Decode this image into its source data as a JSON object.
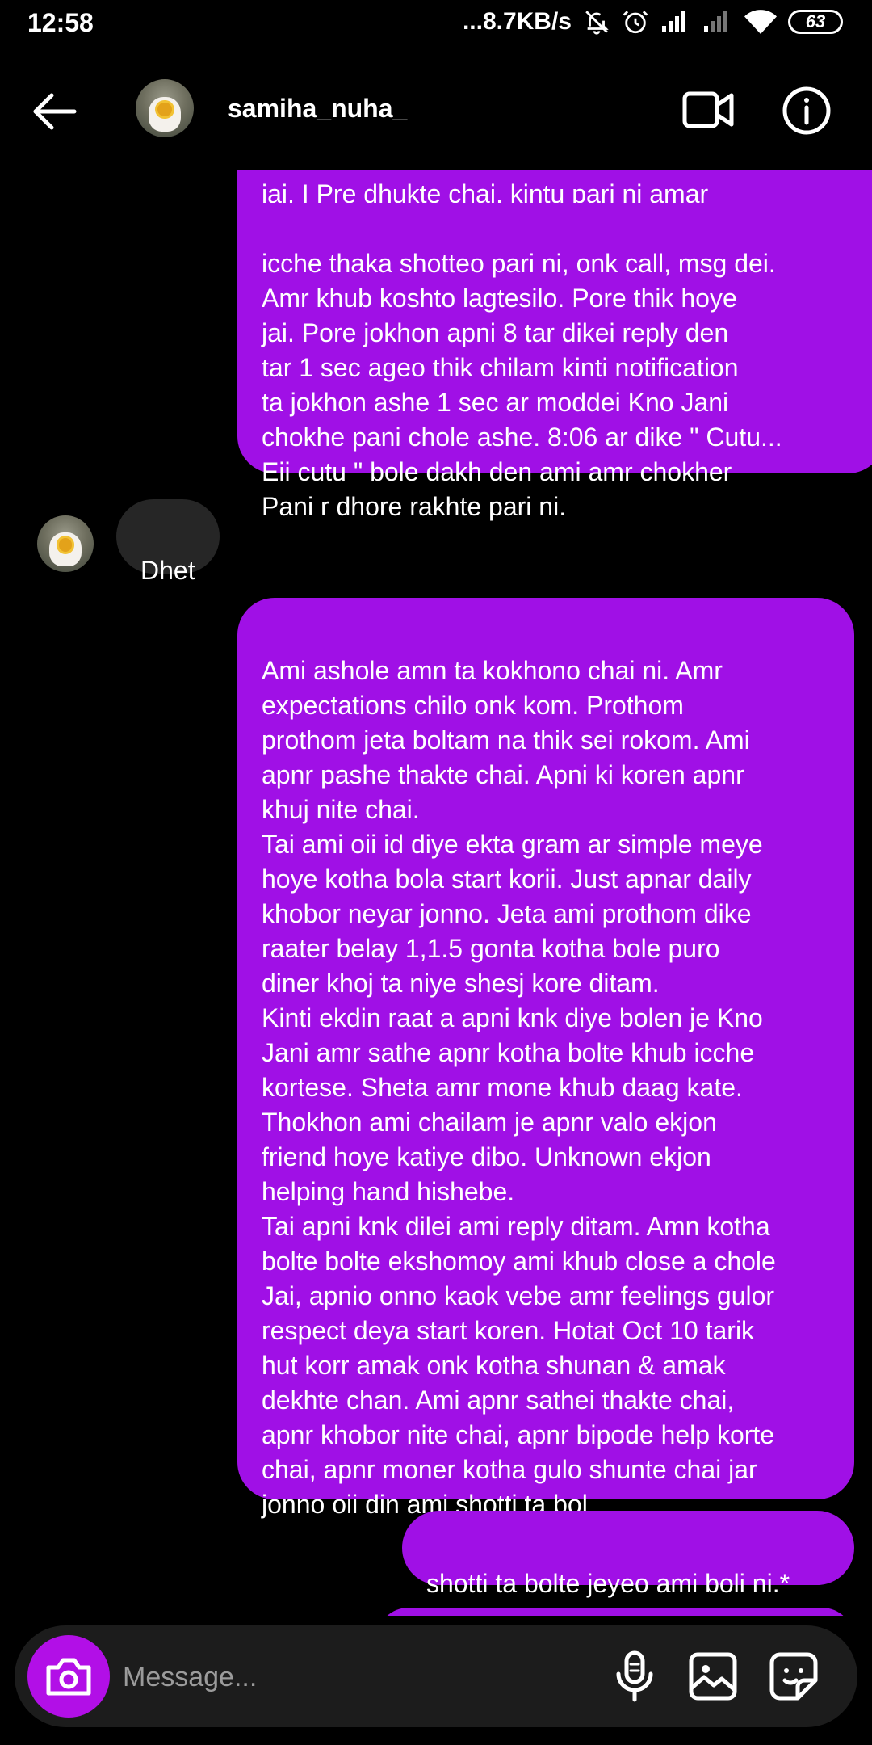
{
  "status_bar": {
    "time": "12:58",
    "network_speed": "...8.7KB/s",
    "battery": "63"
  },
  "header": {
    "username": "samiha_nuha_"
  },
  "messages": [
    {
      "type": "sent",
      "clipped_first_line": "jai, I Pre dhukte chai, kintu pari ni amar",
      "text": "icche thaka shotteo pari ni, onk call, msg dei.\nAmr khub koshto lagtesilo. Pore thik hoye\njai. Pore jokhon apni 8 tar dikei reply den\ntar 1 sec ageo thik chilam kinti notification\nta jokhon ashe 1 sec ar moddei Kno Jani\nchokhe pani chole ashe. 8:06 ar dike \" Cutu...\nEii cutu \" bole dakh den ami amr chokher\nPani r dhore rakhte pari ni."
    },
    {
      "type": "received",
      "text": "Dhet"
    },
    {
      "type": "sent",
      "text": "Ami ashole amn ta kokhono chai ni. Amr\nexpectations chilo onk kom. Prothom\nprothom jeta boltam na thik sei rokom. Ami\napnr pashe thakte chai. Apni ki koren apnr\nkhuj nite chai.\nTai ami oii id diye ekta gram ar simple meye\nhoye kotha bola start korii. Just apnar daily\nkhobor neyar jonno. Jeta ami prothom dike\nraater belay 1,1.5 gonta kotha bole puro\ndiner khoj ta niye shesj kore ditam.\nKinti ekdin raat a apni knk diye bolen je Kno\nJani amr sathe apnr kotha bolte khub icche\nkortese. Sheta amr mone khub daag kate.\nThokhon ami chailam je apnr valo ekjon\nfriend hoye katiye dibo. Unknown ekjon\nhelping hand hishebe.\nTai apni knk dilei ami reply ditam. Amn kotha\nbolte bolte ekshomoy ami khub close a chole\nJai, apnio onno kaok vebe amr feelings gulor\nrespect deya start koren. Hotat Oct 10 tarik\nhut korr amak onk kotha shunan & amak\ndekhte chan. Ami apnr sathei thakte chai,\napnr khobor nite chai, apnr bipode help korte\nchai, apnr moner kotha gulo shunte chai jar\njonno oii din ami shotti ta bol"
    },
    {
      "type": "sent",
      "text": "shotti ta bolte jeyeo ami boli ni.*"
    }
  ],
  "composer": {
    "placeholder": "Message..."
  },
  "colors": {
    "sent_bubble": "#a010e6",
    "received_bubble": "#262626",
    "camera_button": "#b20fe7",
    "background": "#000000"
  },
  "icons": {
    "back": "arrow-left-icon",
    "video": "video-camera-icon",
    "info": "info-icon",
    "camera": "camera-icon",
    "mic": "microphone-icon",
    "gallery": "image-icon",
    "sticker": "sticker-icon"
  }
}
